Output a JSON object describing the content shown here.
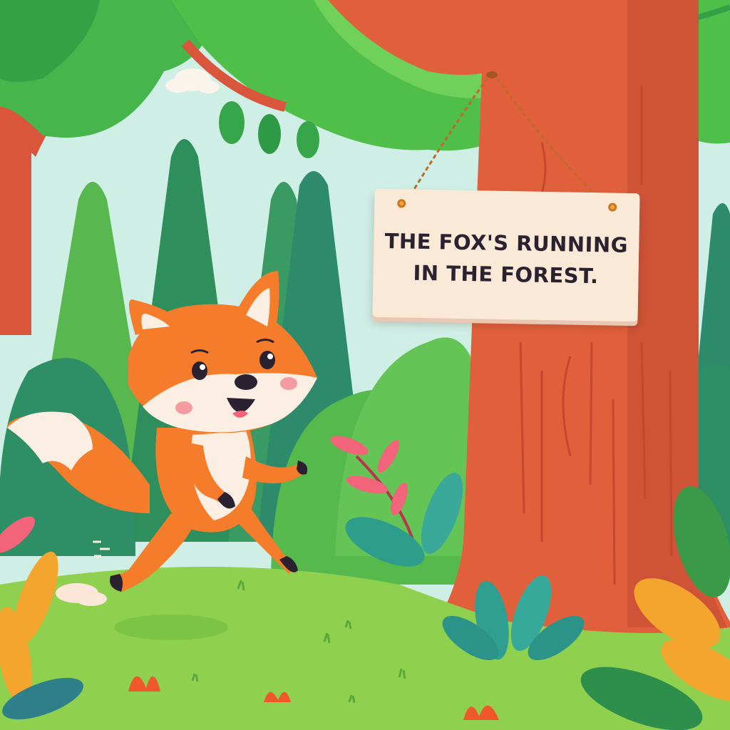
{
  "scene": {
    "sign": {
      "line1": "THE FOX'S RUNNING",
      "line2": "IN THE FOREST."
    },
    "colors": {
      "sky": "#cfeee6",
      "grass": "#8fd14f",
      "treeTrunk": "#e0603c",
      "canopy": "#4fbf4a",
      "fox": "#f47c2a",
      "signBoard": "#fbe9d7"
    },
    "elements": [
      "fox",
      "big-tree",
      "hanging-sign",
      "pine-trees",
      "bushes",
      "leafy-plants",
      "clouds"
    ]
  }
}
